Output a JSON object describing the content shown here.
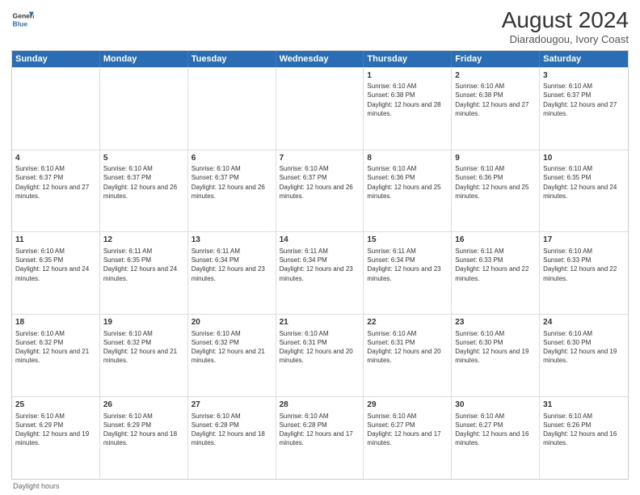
{
  "logo": {
    "line1": "General",
    "line2": "Blue"
  },
  "title": "August 2024",
  "subtitle": "Diaradougou, Ivory Coast",
  "days_of_week": [
    "Sunday",
    "Monday",
    "Tuesday",
    "Wednesday",
    "Thursday",
    "Friday",
    "Saturday"
  ],
  "footer": "Daylight hours",
  "weeks": [
    [
      {
        "day": "",
        "sunrise": "",
        "sunset": "",
        "daylight": ""
      },
      {
        "day": "",
        "sunrise": "",
        "sunset": "",
        "daylight": ""
      },
      {
        "day": "",
        "sunrise": "",
        "sunset": "",
        "daylight": ""
      },
      {
        "day": "",
        "sunrise": "",
        "sunset": "",
        "daylight": ""
      },
      {
        "day": "1",
        "sunrise": "Sunrise: 6:10 AM",
        "sunset": "Sunset: 6:38 PM",
        "daylight": "Daylight: 12 hours and 28 minutes."
      },
      {
        "day": "2",
        "sunrise": "Sunrise: 6:10 AM",
        "sunset": "Sunset: 6:38 PM",
        "daylight": "Daylight: 12 hours and 27 minutes."
      },
      {
        "day": "3",
        "sunrise": "Sunrise: 6:10 AM",
        "sunset": "Sunset: 6:37 PM",
        "daylight": "Daylight: 12 hours and 27 minutes."
      }
    ],
    [
      {
        "day": "4",
        "sunrise": "Sunrise: 6:10 AM",
        "sunset": "Sunset: 6:37 PM",
        "daylight": "Daylight: 12 hours and 27 minutes."
      },
      {
        "day": "5",
        "sunrise": "Sunrise: 6:10 AM",
        "sunset": "Sunset: 6:37 PM",
        "daylight": "Daylight: 12 hours and 26 minutes."
      },
      {
        "day": "6",
        "sunrise": "Sunrise: 6:10 AM",
        "sunset": "Sunset: 6:37 PM",
        "daylight": "Daylight: 12 hours and 26 minutes."
      },
      {
        "day": "7",
        "sunrise": "Sunrise: 6:10 AM",
        "sunset": "Sunset: 6:37 PM",
        "daylight": "Daylight: 12 hours and 26 minutes."
      },
      {
        "day": "8",
        "sunrise": "Sunrise: 6:10 AM",
        "sunset": "Sunset: 6:36 PM",
        "daylight": "Daylight: 12 hours and 25 minutes."
      },
      {
        "day": "9",
        "sunrise": "Sunrise: 6:10 AM",
        "sunset": "Sunset: 6:36 PM",
        "daylight": "Daylight: 12 hours and 25 minutes."
      },
      {
        "day": "10",
        "sunrise": "Sunrise: 6:10 AM",
        "sunset": "Sunset: 6:35 PM",
        "daylight": "Daylight: 12 hours and 24 minutes."
      }
    ],
    [
      {
        "day": "11",
        "sunrise": "Sunrise: 6:10 AM",
        "sunset": "Sunset: 6:35 PM",
        "daylight": "Daylight: 12 hours and 24 minutes."
      },
      {
        "day": "12",
        "sunrise": "Sunrise: 6:11 AM",
        "sunset": "Sunset: 6:35 PM",
        "daylight": "Daylight: 12 hours and 24 minutes."
      },
      {
        "day": "13",
        "sunrise": "Sunrise: 6:11 AM",
        "sunset": "Sunset: 6:34 PM",
        "daylight": "Daylight: 12 hours and 23 minutes."
      },
      {
        "day": "14",
        "sunrise": "Sunrise: 6:11 AM",
        "sunset": "Sunset: 6:34 PM",
        "daylight": "Daylight: 12 hours and 23 minutes."
      },
      {
        "day": "15",
        "sunrise": "Sunrise: 6:11 AM",
        "sunset": "Sunset: 6:34 PM",
        "daylight": "Daylight: 12 hours and 23 minutes."
      },
      {
        "day": "16",
        "sunrise": "Sunrise: 6:11 AM",
        "sunset": "Sunset: 6:33 PM",
        "daylight": "Daylight: 12 hours and 22 minutes."
      },
      {
        "day": "17",
        "sunrise": "Sunrise: 6:10 AM",
        "sunset": "Sunset: 6:33 PM",
        "daylight": "Daylight: 12 hours and 22 minutes."
      }
    ],
    [
      {
        "day": "18",
        "sunrise": "Sunrise: 6:10 AM",
        "sunset": "Sunset: 6:32 PM",
        "daylight": "Daylight: 12 hours and 21 minutes."
      },
      {
        "day": "19",
        "sunrise": "Sunrise: 6:10 AM",
        "sunset": "Sunset: 6:32 PM",
        "daylight": "Daylight: 12 hours and 21 minutes."
      },
      {
        "day": "20",
        "sunrise": "Sunrise: 6:10 AM",
        "sunset": "Sunset: 6:32 PM",
        "daylight": "Daylight: 12 hours and 21 minutes."
      },
      {
        "day": "21",
        "sunrise": "Sunrise: 6:10 AM",
        "sunset": "Sunset: 6:31 PM",
        "daylight": "Daylight: 12 hours and 20 minutes."
      },
      {
        "day": "22",
        "sunrise": "Sunrise: 6:10 AM",
        "sunset": "Sunset: 6:31 PM",
        "daylight": "Daylight: 12 hours and 20 minutes."
      },
      {
        "day": "23",
        "sunrise": "Sunrise: 6:10 AM",
        "sunset": "Sunset: 6:30 PM",
        "daylight": "Daylight: 12 hours and 19 minutes."
      },
      {
        "day": "24",
        "sunrise": "Sunrise: 6:10 AM",
        "sunset": "Sunset: 6:30 PM",
        "daylight": "Daylight: 12 hours and 19 minutes."
      }
    ],
    [
      {
        "day": "25",
        "sunrise": "Sunrise: 6:10 AM",
        "sunset": "Sunset: 6:29 PM",
        "daylight": "Daylight: 12 hours and 19 minutes."
      },
      {
        "day": "26",
        "sunrise": "Sunrise: 6:10 AM",
        "sunset": "Sunset: 6:29 PM",
        "daylight": "Daylight: 12 hours and 18 minutes."
      },
      {
        "day": "27",
        "sunrise": "Sunrise: 6:10 AM",
        "sunset": "Sunset: 6:28 PM",
        "daylight": "Daylight: 12 hours and 18 minutes."
      },
      {
        "day": "28",
        "sunrise": "Sunrise: 6:10 AM",
        "sunset": "Sunset: 6:28 PM",
        "daylight": "Daylight: 12 hours and 17 minutes."
      },
      {
        "day": "29",
        "sunrise": "Sunrise: 6:10 AM",
        "sunset": "Sunset: 6:27 PM",
        "daylight": "Daylight: 12 hours and 17 minutes."
      },
      {
        "day": "30",
        "sunrise": "Sunrise: 6:10 AM",
        "sunset": "Sunset: 6:27 PM",
        "daylight": "Daylight: 12 hours and 16 minutes."
      },
      {
        "day": "31",
        "sunrise": "Sunrise: 6:10 AM",
        "sunset": "Sunset: 6:26 PM",
        "daylight": "Daylight: 12 hours and 16 minutes."
      }
    ]
  ]
}
